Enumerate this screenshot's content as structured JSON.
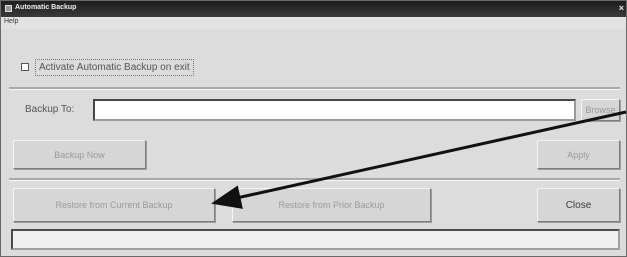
{
  "window": {
    "title": "Automatic Backup",
    "close_glyph": "×",
    "menu": [
      "Help"
    ]
  },
  "options": {
    "activate_label": "Activate Automatic Backup on exit",
    "activate_checked": false
  },
  "backup_to": {
    "label": "Backup To:",
    "value": "",
    "placeholder": ""
  },
  "buttons": {
    "browse": "Browse",
    "backup_now": "Backup Now",
    "apply": "Apply",
    "restore_current": "Restore from Current Backup",
    "restore_prior": "Restore from Prior Backup",
    "close": "Close"
  },
  "status_bar": {
    "text": ""
  },
  "icons": {
    "app_icon": "app-icon",
    "close_icon": "close-icon",
    "annotation": "annotation-arrow"
  }
}
